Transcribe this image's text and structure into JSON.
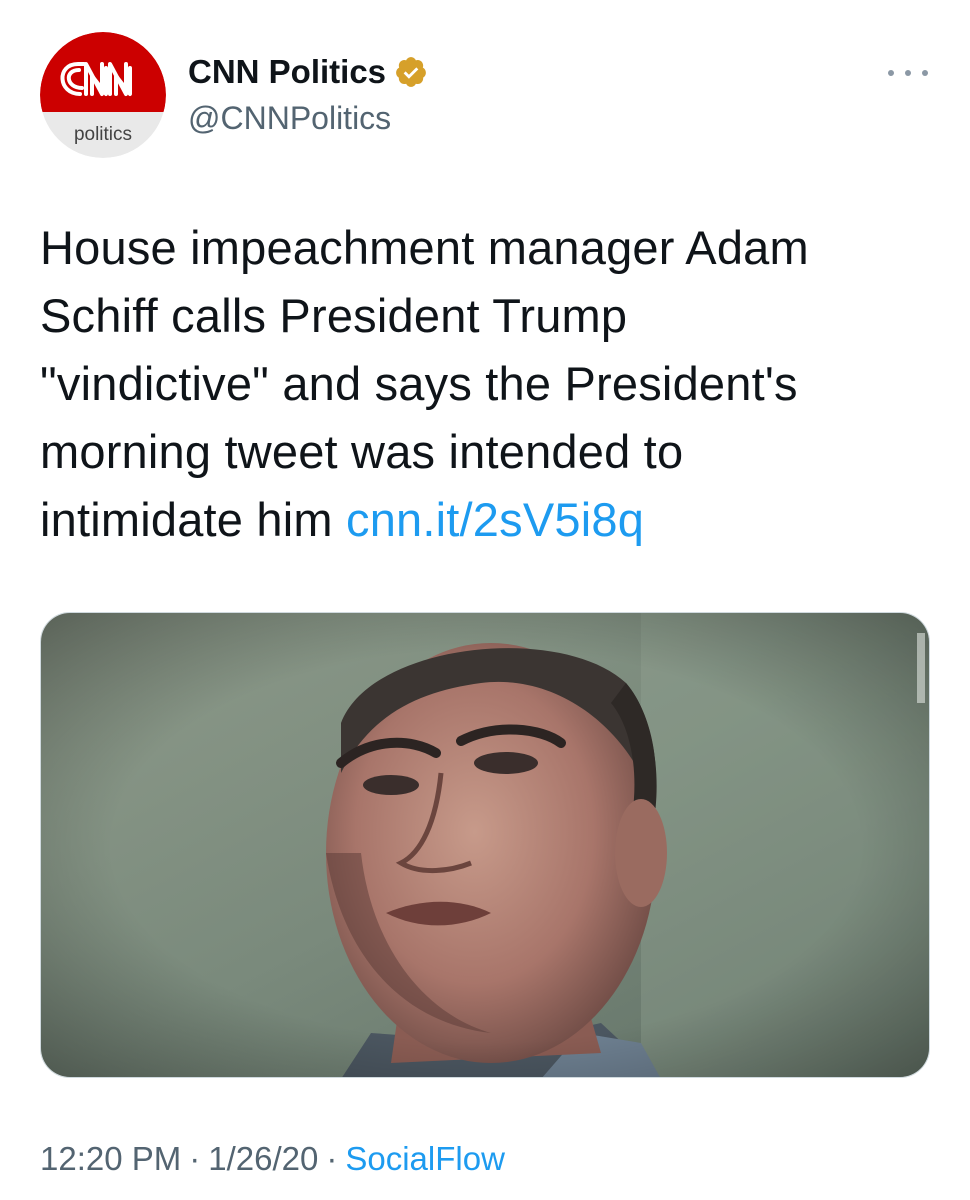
{
  "author": {
    "display_name": "CNN Politics",
    "handle": "@CNNPolitics",
    "avatar": {
      "logo_text": "CNN",
      "sub_text": "politics",
      "logo_color": "#cc0000"
    },
    "verified_badge_color": "#d6a02a"
  },
  "tweet": {
    "text": "House impeachment manager Adam Schiff calls President Trump \"vindictive\" and says the President's morning tweet was intended to intimidate him",
    "lines": [
      "House impeachment manager Adam",
      "Schiff calls President Trump",
      "\"vindictive\" and says the President's",
      "morning tweet was intended to",
      "intimidate him "
    ],
    "link_text": "cnn.it/2sV5i8q",
    "link_color": "#1d9bf0"
  },
  "media": {
    "type": "photo",
    "subject": "close-up-portrait"
  },
  "footer": {
    "time": "12:20 PM",
    "separator": "·",
    "date": "1/26/20",
    "source": "SocialFlow"
  },
  "menu": {
    "icon": "more-horizontal-icon"
  }
}
